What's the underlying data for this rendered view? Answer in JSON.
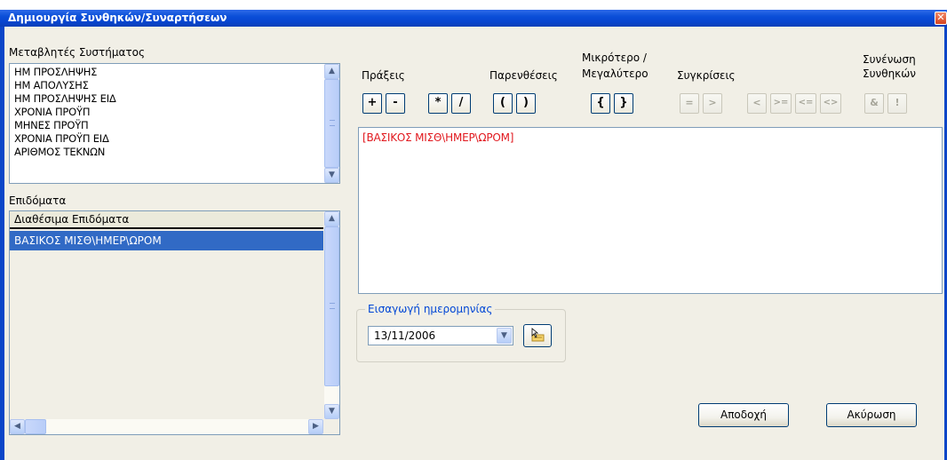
{
  "window": {
    "title": "Δημιουργία Συνθηκών/Συναρτήσεων",
    "close_glyph": "✕"
  },
  "system_vars": {
    "label": "Μεταβλητές Συστήματος",
    "items": [
      "ΗΜ ΠΡΟΣΛΗΨΗΣ",
      "ΗΜ ΑΠΟΛΥΣΗΣ",
      "ΗΜ ΠΡΟΣΛΗΨΗΣ ΕΙΔ",
      "ΧΡΟΝΙΑ ΠΡΟΫΠ",
      "ΜΗΝΕΣ ΠΡΟΫΠ",
      "ΧΡΟΝΙΑ ΠΡΟΫΠ ΕΙΔ",
      "ΑΡΙΘΜΟΣ ΤΕΚΝΩΝ"
    ]
  },
  "allowances": {
    "label": "Επιδόματα",
    "column_header": "Διαθέσιμα Επιδόματα",
    "items": [
      "ΒΑΣΙΚΟΣ ΜΙΣΘ\\ΗΜΕΡ\\ΩΡΟΜ"
    ],
    "selected_index": 0
  },
  "toolbar": {
    "operations": {
      "label": "Πράξεις",
      "buttons": [
        "+",
        "-",
        "*",
        "/"
      ]
    },
    "parentheses": {
      "label": "Παρενθέσεις",
      "buttons": [
        "(",
        ")"
      ]
    },
    "less_greater": {
      "label_line1": "Μικρότερο /",
      "label_line2": "Μεγαλύτερο",
      "buttons": [
        "{",
        "}"
      ]
    },
    "comparisons": {
      "label": "Συγκρίσεις",
      "buttons": [
        "=",
        ">",
        "<",
        ">=",
        "<=",
        "<>"
      ]
    },
    "conjunction": {
      "label_line1": "Συνένωση",
      "label_line2": "Συνθηκών",
      "buttons": [
        "&",
        "!"
      ]
    }
  },
  "editor": {
    "content": "[ΒΑΣΙΚΟΣ ΜΙΣΘ\\ΗΜΕΡ\\ΩΡΟΜ]",
    "content_color": "#e1181e"
  },
  "date_group": {
    "legend": "Εισαγωγή ημερομηνίας",
    "date_value": "13/11/2006",
    "calendar_icon": "calendar-picker-icon"
  },
  "actions": {
    "accept": "Αποδοχή",
    "cancel": "Ακύρωση"
  },
  "colors": {
    "titlebar": "#0a4ed8",
    "dialog_bg": "#f1efe6",
    "selection": "#316ac5",
    "legend_text": "#0046d5"
  }
}
